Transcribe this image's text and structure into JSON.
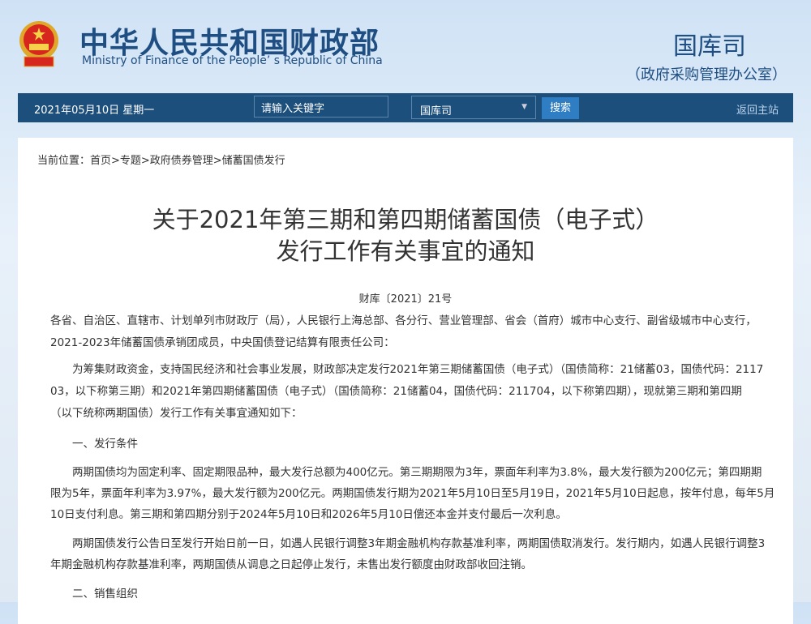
{
  "header": {
    "site_cn": "中华人民共和国财政部",
    "site_en": "Ministry of Finance of the People’ s Republic of China",
    "dept": "国库司",
    "dept_sub": "（政府采购管理办公室）"
  },
  "nav": {
    "date": "2021年05月10日  星期一",
    "search_placeholder": "请输入关键字",
    "select_value": "国库司",
    "search_button": "搜索",
    "home_link": "返回主站"
  },
  "breadcrumb": "当前位置：首页>专题>政府债券管理>储蓄国债发行",
  "article": {
    "title_lines": [
      "关于2021年第三期和第四期储蓄国债（电子式）",
      "发行工作有关事宜的通知"
    ],
    "doc_no": "财库〔2021〕21号",
    "lines": [
      "各省、自治区、直辖市、计划单列市财政厅（局），人民银行上海总部、各分行、营业管理部、省会（首府）城市中心支行、副省级城市中心支行，",
      "2021-2023年储蓄国债承销团成员，中央国债登记结算有限责任公司：",
      "　　为筹集财政资金，支持国民经济和社会事业发展，财政部决定发行2021年第三期储蓄国债（电子式）（国债简称：21储蓄03，国债代码：2117",
      "03，以下称第三期）和2021年第四期储蓄国债（电子式）（国债简称：21储蓄04，国债代码：211704，以下称第四期），现就第三期和第四期",
      "（以下统称两期国债）发行工作有关事宜通知如下：",
      "　　一、发行条件",
      "　　两期国债均为固定利率、固定期限品种，最大发行总额为400亿元。第三期期限为3年，票面年利率为3.8%，最大发行额为200亿元；第四期期",
      "限为5年，票面年利率为3.97%，最大发行额为200亿元。两期国债发行期为2021年5月10日至5月19日，2021年5月10日起息，按年付息，每年5月",
      "10日支付利息。第三期和第四期分别于2024年5月10日和2026年5月10日偿还本金并支付最后一次利息。",
      "　　两期国债发行公告日至发行开始日前一日，如遇人民银行调整3年期金融机构存款基准利率，两期国债取消发行。发行期内，如遇人民银行调整3",
      "年期金融机构存款基准利率，两期国债从调息之日起停止发行，未售出发行额度由财政部收回注销。",
      "　　二、销售组织"
    ]
  }
}
